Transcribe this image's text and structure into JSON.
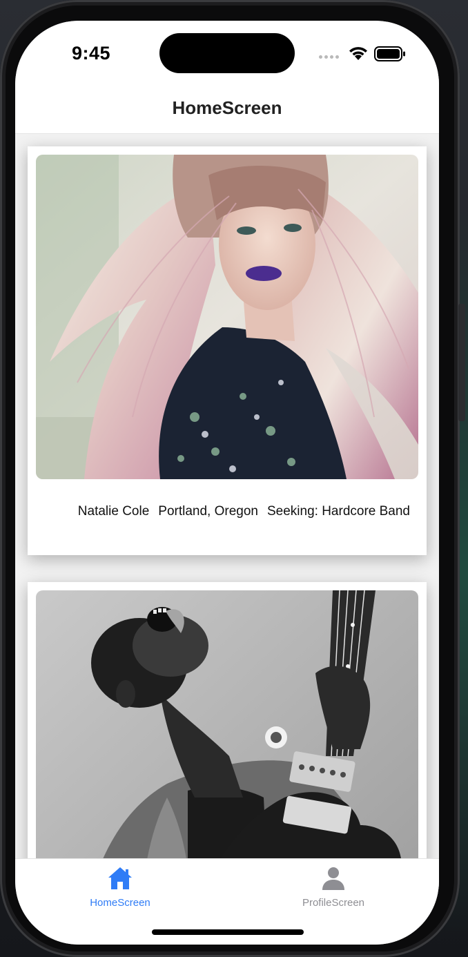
{
  "status_bar": {
    "time": "9:45"
  },
  "header": {
    "title": "HomeScreen"
  },
  "feed": {
    "cards": [
      {
        "name": "Natalie Cole",
        "location": "Portland, Oregon",
        "seeking": "Seeking: Hardcore Band",
        "image": "woman-with-pink-hair-photo"
      },
      {
        "image": "guitarist-black-and-white-photo"
      }
    ]
  },
  "tab_bar": {
    "tabs": [
      {
        "label": "HomeScreen",
        "icon": "home-icon",
        "active": true
      },
      {
        "label": "ProfileScreen",
        "icon": "person-icon",
        "active": false
      }
    ],
    "active_color": "#2f7cf6",
    "inactive_color": "#8e8e93"
  }
}
